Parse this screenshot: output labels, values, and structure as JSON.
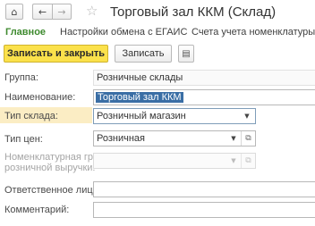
{
  "window": {
    "title": "Торговый зал ККМ (Склад)"
  },
  "tabs": {
    "main": "Главное",
    "egais": "Настройки обмена с ЕГАИС",
    "accounts": "Счета учета номенклатуры"
  },
  "toolbar": {
    "save_close_label": "Записать и закрыть",
    "save_label": "Записать"
  },
  "form": {
    "group": {
      "label": "Группа:",
      "value": "Розничные склады"
    },
    "name": {
      "label": "Наименование:",
      "value": "Торговый зал ККМ"
    },
    "warehouse_type": {
      "label": "Тип склада:",
      "value": "Розничный магазин"
    },
    "price_type": {
      "label": "Тип цен:",
      "value": "Розничная"
    },
    "retail_group": {
      "label_line1": "Номенклатурная группа",
      "label_line2": "розничной выручки:",
      "value": ""
    },
    "responsible": {
      "label": "Ответственное лицо:",
      "value": ""
    },
    "comment": {
      "label": "Комментарий:",
      "value": ""
    }
  },
  "icons": {
    "home": "home-icon",
    "back": "arrow-left-icon",
    "forward": "arrow-right-icon",
    "favorite": "star-icon",
    "more": "document-list-icon",
    "dropdown": "triangle-down-icon",
    "open": "open-link-icon"
  }
}
